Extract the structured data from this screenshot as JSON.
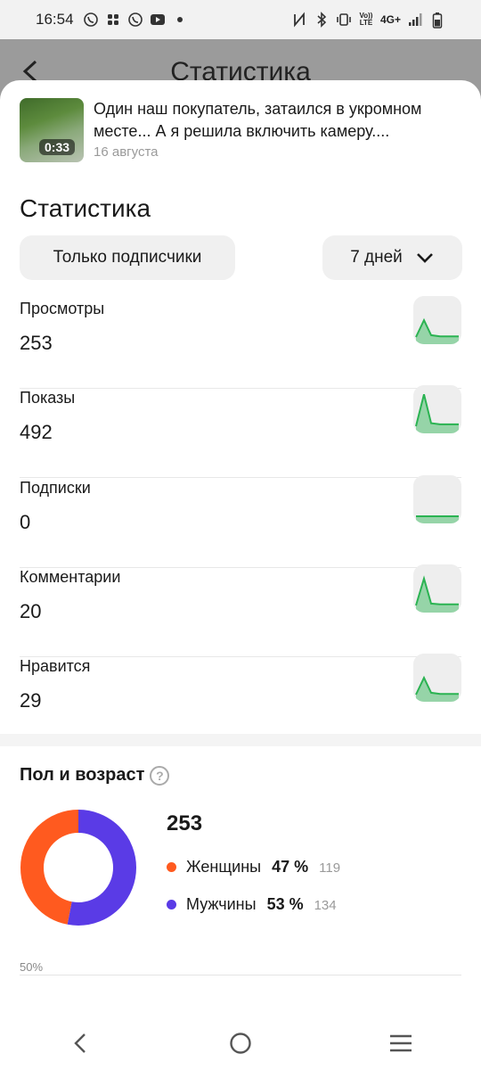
{
  "status_bar": {
    "time": "16:54",
    "left_icons": [
      "viber-icon",
      "slack-icon",
      "viber-icon",
      "youtube-icon",
      "dot-icon"
    ],
    "right_icons": [
      "nfc-icon",
      "bluetooth-icon",
      "vibrate-icon",
      "volte-icon",
      "signal-icon",
      "battery-icon"
    ],
    "network": "4G+",
    "volte": "Vo)) LTE"
  },
  "background_page": {
    "title": "Статистика"
  },
  "video": {
    "duration": "0:33",
    "title": "Один наш покупатель, затаился в укромном месте... А я решила включить камеру....",
    "date": "16 августа"
  },
  "stats": {
    "title": "Статистика",
    "audience_filter": "Только подписчики",
    "period_filter": "7 дней",
    "metrics": [
      {
        "label": "Просмотры",
        "value": "253",
        "trend": [
          0.45,
          0.05,
          0.02,
          0.02,
          0.02
        ]
      },
      {
        "label": "Показы",
        "value": "492",
        "trend": [
          0.85,
          0.08,
          0.05,
          0.05,
          0.05
        ]
      },
      {
        "label": "Подписки",
        "value": "0",
        "trend": [
          0,
          0,
          0,
          0,
          0
        ]
      },
      {
        "label": "Комментарии",
        "value": "20",
        "trend": [
          0.72,
          0.05,
          0.03,
          0.03,
          0.03
        ]
      },
      {
        "label": "Нравится",
        "value": "29",
        "trend": [
          0.45,
          0.05,
          0.02,
          0.02,
          0.02
        ]
      }
    ],
    "accent_color": "#2bb352"
  },
  "demographics": {
    "title": "Пол и возраст",
    "total": "253",
    "groups": [
      {
        "label": "Женщины",
        "percent": "47 %",
        "count": "119",
        "share": 0.47,
        "color": "#ff5a1f"
      },
      {
        "label": "Мужчины",
        "percent": "53 %",
        "count": "134",
        "share": 0.53,
        "color": "#5a3be6"
      }
    ],
    "axis_label": "50%"
  },
  "nav_bar": {
    "buttons": [
      "back-icon",
      "home-icon",
      "recents-icon"
    ]
  }
}
